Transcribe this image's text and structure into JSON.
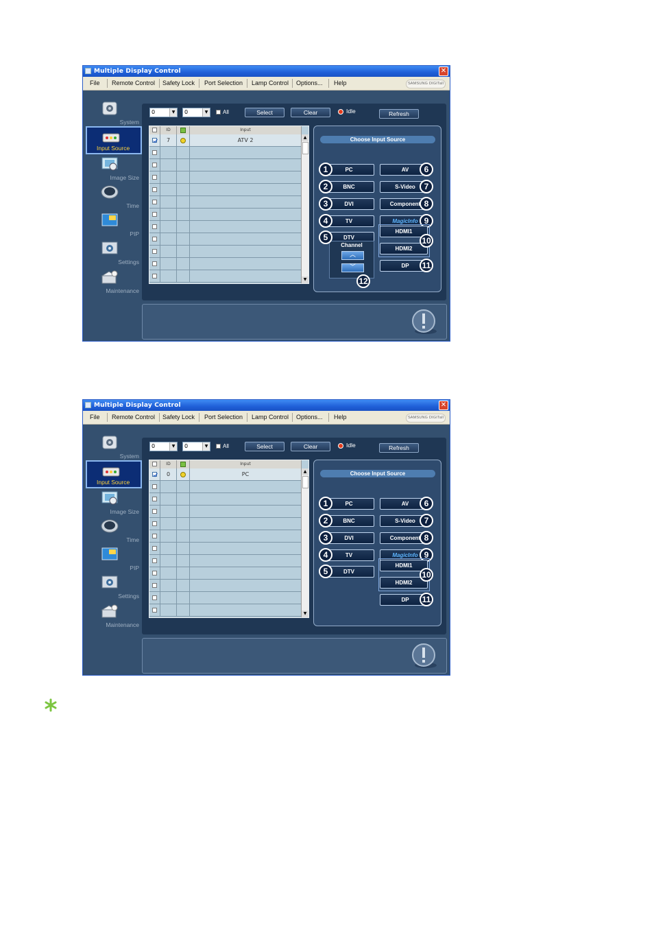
{
  "windows": [
    {
      "title": "Multiple Display Control",
      "close_glyph": "✕",
      "menu": [
        "File",
        "Remote Control",
        "Safety Lock",
        "Port Selection",
        "Lamp Control",
        "Options...",
        "Help"
      ],
      "brand": "SAMSUNG DIGITall",
      "sidebar": [
        {
          "label": "System",
          "icon": "system-icon"
        },
        {
          "label": "Input Source",
          "icon": "input-source-icon",
          "active": true
        },
        {
          "label": "Image Size",
          "icon": "image-size-icon"
        },
        {
          "label": "Time",
          "icon": "time-icon"
        },
        {
          "label": "PIP",
          "icon": "pip-icon"
        },
        {
          "label": "Settings",
          "icon": "settings-icon"
        },
        {
          "label": "Maintenance",
          "icon": "maintenance-icon"
        }
      ],
      "toolbar": {
        "combo1": "0",
        "combo2": "0",
        "all_label": "All",
        "select_label": "Select",
        "clear_label": "Clear",
        "status": "Idle",
        "refresh_label": "Refresh"
      },
      "grid": {
        "headers": [
          "",
          "ID",
          "",
          "Input"
        ],
        "rows": [
          {
            "id": "7",
            "input": "ATV 2",
            "checked": true,
            "status": "yellow"
          }
        ],
        "empty_rows": 11
      },
      "panel": {
        "title": "Choose Input Source",
        "buttons_left": [
          {
            "num": "1",
            "label": "PC"
          },
          {
            "num": "2",
            "label": "BNC"
          },
          {
            "num": "3",
            "label": "DVI"
          },
          {
            "num": "4",
            "label": "TV"
          },
          {
            "num": "5",
            "label": "DTV"
          }
        ],
        "buttons_right": [
          {
            "num": "6",
            "label": "AV"
          },
          {
            "num": "7",
            "label": "S-Video"
          },
          {
            "num": "8",
            "label": "Component"
          },
          {
            "num": "9",
            "label": "MagicInfo"
          }
        ],
        "hdmi": [
          {
            "label": "HDMI1"
          },
          {
            "label": "HDMI2"
          }
        ],
        "hdmi_num": "10",
        "dp": {
          "num": "11",
          "label": "DP"
        },
        "channel": {
          "label": "Channel",
          "num": "12",
          "up": "︿",
          "down": "﹀"
        }
      }
    },
    {
      "title": "Multiple Display Control",
      "close_glyph": "✕",
      "menu": [
        "File",
        "Remote Control",
        "Safety Lock",
        "Port Selection",
        "Lamp Control",
        "Options...",
        "Help"
      ],
      "brand": "SAMSUNG DIGITall",
      "sidebar": [
        {
          "label": "System",
          "icon": "system-icon"
        },
        {
          "label": "Input Source",
          "icon": "input-source-icon",
          "active": true
        },
        {
          "label": "Image Size",
          "icon": "image-size-icon"
        },
        {
          "label": "Time",
          "icon": "time-icon"
        },
        {
          "label": "PIP",
          "icon": "pip-icon"
        },
        {
          "label": "Settings",
          "icon": "settings-icon"
        },
        {
          "label": "Maintenance",
          "icon": "maintenance-icon"
        }
      ],
      "toolbar": {
        "combo1": "0",
        "combo2": "0",
        "all_label": "All",
        "select_label": "Select",
        "clear_label": "Clear",
        "status": "Idle",
        "refresh_label": "Refresh"
      },
      "grid": {
        "headers": [
          "",
          "ID",
          "",
          "Input"
        ],
        "rows": [
          {
            "id": "0",
            "input": "PC",
            "checked": true,
            "status": "yellow"
          }
        ],
        "empty_rows": 11
      },
      "panel": {
        "title": "Choose Input Source",
        "buttons_left": [
          {
            "num": "1",
            "label": "PC"
          },
          {
            "num": "2",
            "label": "BNC"
          },
          {
            "num": "3",
            "label": "DVI"
          },
          {
            "num": "4",
            "label": "TV"
          },
          {
            "num": "5",
            "label": "DTV"
          }
        ],
        "buttons_right": [
          {
            "num": "6",
            "label": "AV"
          },
          {
            "num": "7",
            "label": "S-Video"
          },
          {
            "num": "8",
            "label": "Component"
          },
          {
            "num": "9",
            "label": "MagicInfo"
          }
        ],
        "hdmi": [
          {
            "label": "HDMI1"
          },
          {
            "label": "HDMI2"
          }
        ],
        "hdmi_num": "10",
        "dp": {
          "num": "11",
          "label": "DP"
        },
        "channel": null
      }
    }
  ],
  "colors": {
    "window_bg": "#34506f",
    "content_bg": "#1f3754",
    "accent_title": "#1f5fd8",
    "active_label": "#ffd43a",
    "note_star": "#7cc540"
  },
  "note_icon": "asterisk-note-icon"
}
